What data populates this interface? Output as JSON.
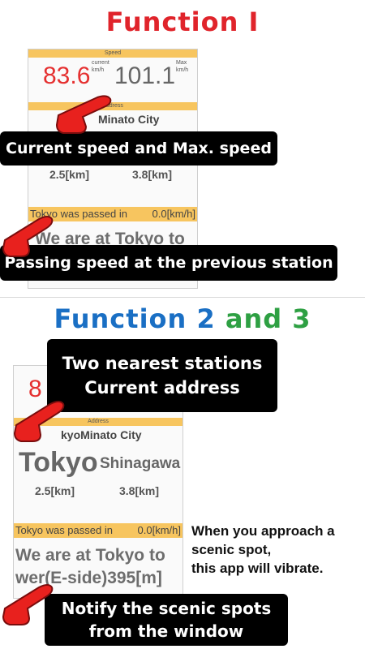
{
  "titles": {
    "function1": "Function I",
    "function23_a": "Function 2",
    "function23_b": "and",
    "function23_c": "3"
  },
  "screen1": {
    "speed_header": "Speed",
    "current_speed": "83.6",
    "current_label": "current",
    "current_unit": "km/h",
    "max_speed": "101.1",
    "max_label": "Max",
    "max_unit": "km/h",
    "address_header": "Address",
    "address_fragment": "Minato City",
    "dist_left": "2.5[km]",
    "dist_right": "3.8[km]",
    "passed_text": "Tokyo was passed in",
    "passed_speed": "0.0[km/h]",
    "big_message": "We are at Tokyo to"
  },
  "screen2": {
    "speed_fragment": "8",
    "address_header": "Address",
    "address": "kyoMinato City",
    "station1": "Tokyo",
    "station2": "Shinagawa",
    "dist_left": "2.5[km]",
    "dist_right": "3.8[km]",
    "passed_text": "Tokyo was passed in",
    "passed_speed": "0.0[km/h]",
    "message_line1": "We are at Tokyo to",
    "message_line2": "wer(E-side)395[m]"
  },
  "callouts": {
    "speed": "Current speed and Max. speed",
    "passing": "Passing speed at the previous station",
    "stations_line1": "Two nearest stations",
    "stations_line2": "Current address",
    "notify_line1": "Notify the scenic spots",
    "notify_line2": "from the window"
  },
  "note": {
    "line1": "When you approach a",
    "line2": "scenic spot,",
    "line3": "this app will vibrate."
  },
  "colors": {
    "title_red": "#e0242b",
    "title_blue": "#1a6fc4",
    "title_green": "#2ea043",
    "bar_yellow": "#f7c55f",
    "speed_red": "#e53030",
    "hand_red": "#e8211e"
  },
  "icons": {
    "pointer": "pointing-hand-icon"
  }
}
